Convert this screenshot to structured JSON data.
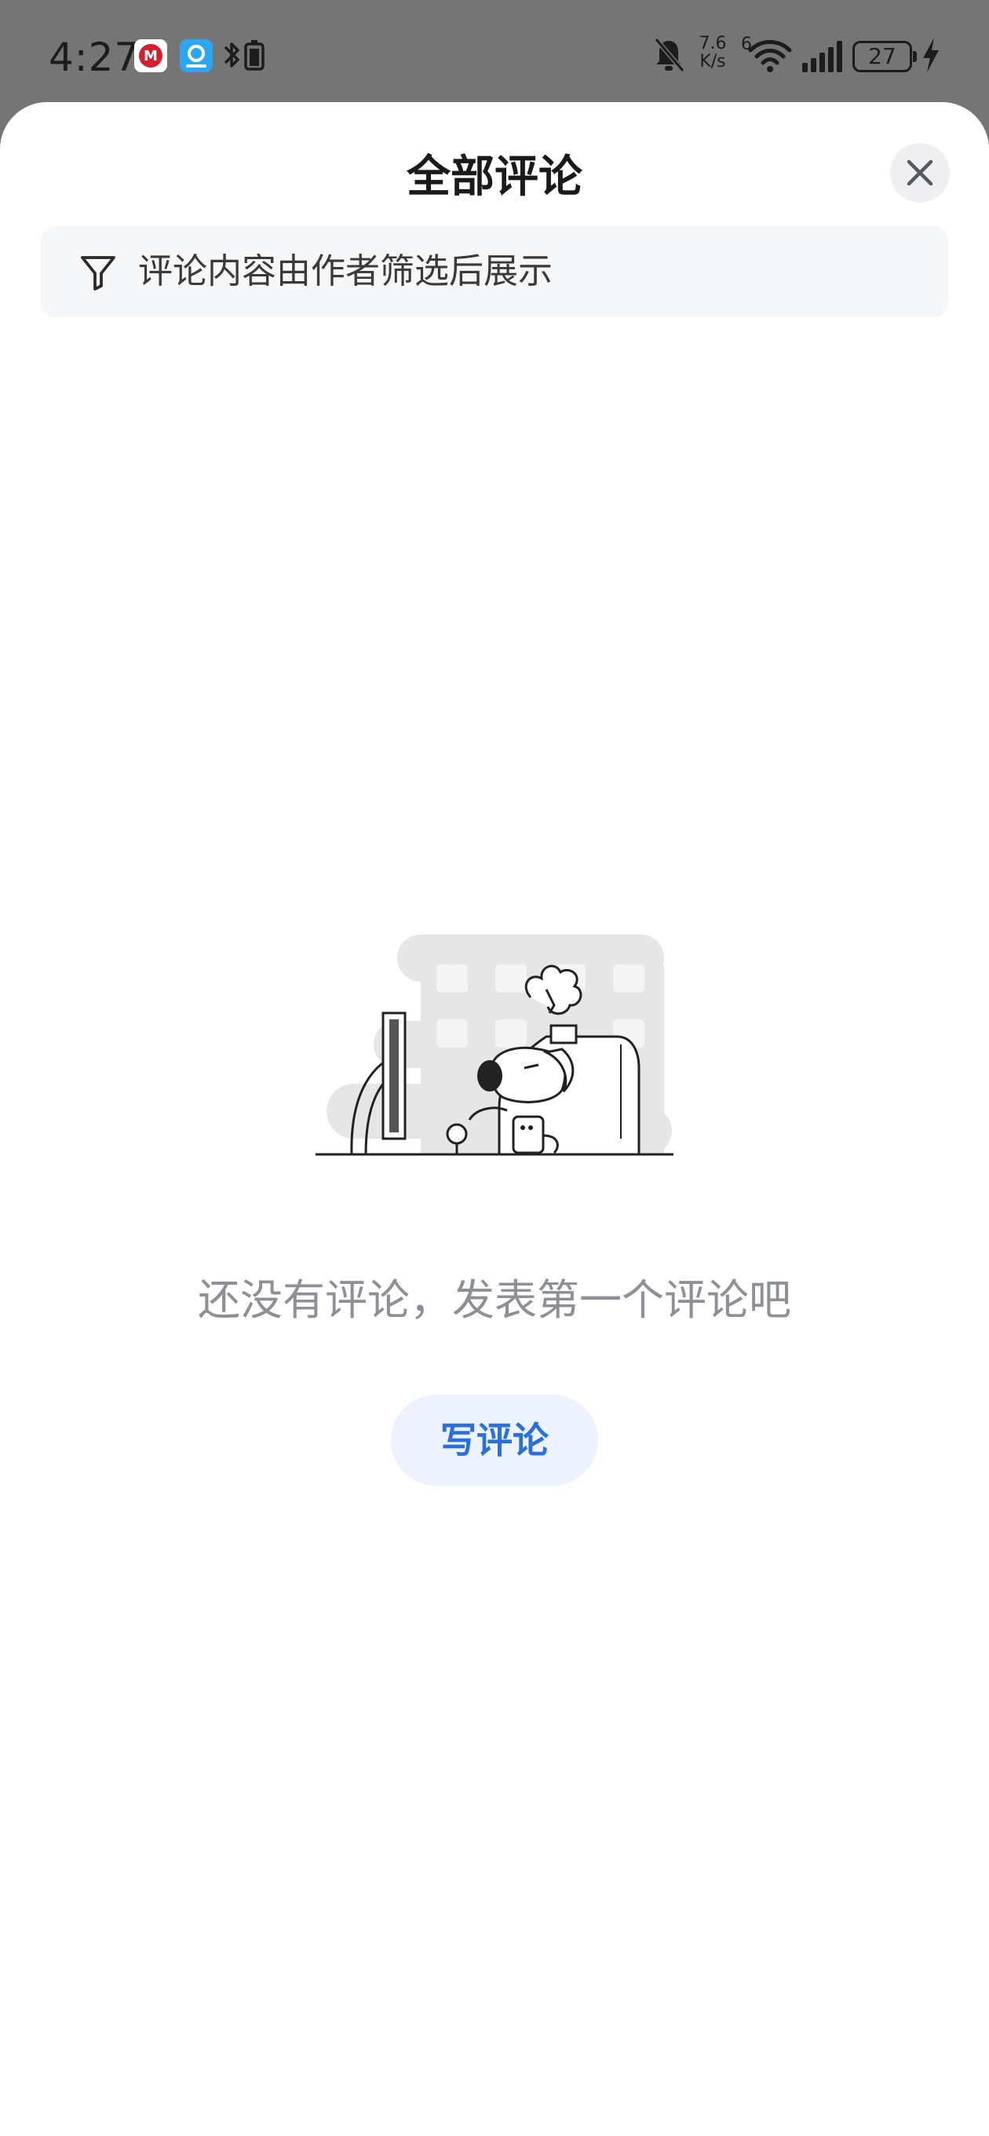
{
  "status_bar": {
    "time": "4:27",
    "network_speed_value": "7.6",
    "network_speed_unit": "K/s",
    "wifi_label": "6",
    "battery_level": "27",
    "icons": [
      "cmb-app-icon",
      "map-app-icon",
      "bluetooth-icon",
      "battery-saver-icon",
      "mute-icon",
      "wifi-icon",
      "signal-icon",
      "battery-icon",
      "charging-icon"
    ]
  },
  "sheet": {
    "title": "全部评论",
    "close_icon": "close-icon",
    "notice": {
      "icon": "filter-icon",
      "text": "评论内容由作者筛选后展示"
    }
  },
  "empty_state": {
    "illustration": "dog-at-computer-illustration",
    "message": "还没有评论，发表第一个评论吧",
    "button_label": "写评论"
  },
  "colors": {
    "accent": "#2a6fdb",
    "button_bg": "#ecf3fe",
    "muted_text": "#8d9097",
    "notice_bg": "#f6f7f9",
    "overlay": "#757575"
  }
}
